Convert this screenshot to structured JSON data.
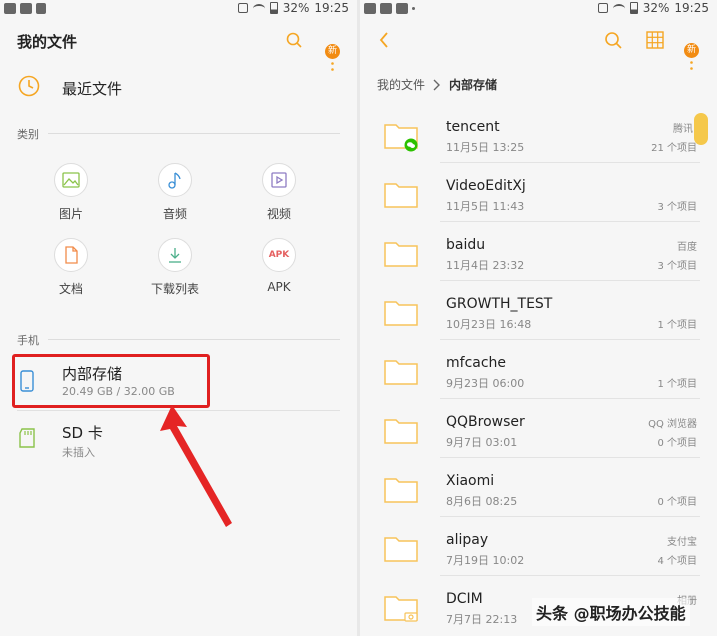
{
  "status_left": {
    "battery": "32%",
    "time": "19:25"
  },
  "status_right": {
    "battery": "32%",
    "time": "19:25"
  },
  "left": {
    "title": "我的文件",
    "badge": "新",
    "recent": "最近文件",
    "category_label": "类别",
    "categories": [
      {
        "label": "图片",
        "icon": "image-icon"
      },
      {
        "label": "音频",
        "icon": "music-icon"
      },
      {
        "label": "视频",
        "icon": "video-icon"
      },
      {
        "label": "文档",
        "icon": "document-icon"
      },
      {
        "label": "下载列表",
        "icon": "download-icon"
      },
      {
        "label": "APK",
        "icon": "apk-icon",
        "icon_text": "APK"
      }
    ],
    "phone_label": "手机",
    "storage": [
      {
        "name": "内部存储",
        "sub": "20.49 GB / 32.00 GB"
      },
      {
        "name": "SD 卡",
        "sub": "未插入"
      }
    ]
  },
  "right": {
    "badge": "新",
    "breadcrumb_root": "我的文件",
    "breadcrumb_current": "内部存储",
    "folders": [
      {
        "name": "tencent",
        "date": "11月5日 13:25",
        "tag": "腾讯",
        "count": "21 个项目"
      },
      {
        "name": "VideoEditXj",
        "date": "11月5日 11:43",
        "tag": "",
        "count": "3 个项目"
      },
      {
        "name": "baidu",
        "date": "11月4日 23:32",
        "tag": "百度",
        "count": "3 个项目"
      },
      {
        "name": "GROWTH_TEST",
        "date": "10月23日 16:48",
        "tag": "",
        "count": "1 个项目"
      },
      {
        "name": "mfcache",
        "date": "9月23日 06:00",
        "tag": "",
        "count": "1 个项目"
      },
      {
        "name": "QQBrowser",
        "date": "9月7日 03:01",
        "tag": "QQ 浏览器",
        "count": "0 个项目"
      },
      {
        "name": "Xiaomi",
        "date": "8月6日 08:25",
        "tag": "",
        "count": "0 个项目"
      },
      {
        "name": "alipay",
        "date": "7月19日 10:02",
        "tag": "支付宝",
        "count": "4 个项目"
      },
      {
        "name": "DCIM",
        "date": "7月7日 22:13",
        "tag": "相册",
        "count": ""
      }
    ]
  },
  "watermark": "头条 @职场办公技能",
  "colors": {
    "accent": "#f5a623",
    "folder": "#f7c35a",
    "highlight": "#e02020",
    "arrow": "#e52525"
  }
}
